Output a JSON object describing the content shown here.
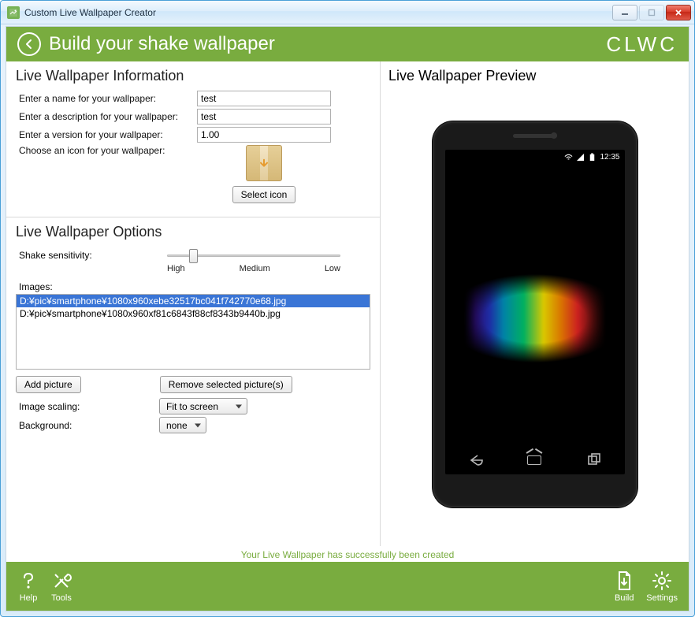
{
  "window": {
    "title": "Custom Live Wallpaper Creator"
  },
  "header": {
    "title": "Build your shake wallpaper",
    "brand": "CLWC"
  },
  "info": {
    "section_title": "Live Wallpaper Information",
    "name_label": "Enter a name for your wallpaper:",
    "name_value": "test",
    "desc_label": "Enter a description for your wallpaper:",
    "desc_value": "test",
    "version_label": "Enter a version for your wallpaper:",
    "version_value": "1.00",
    "icon_label": "Choose an icon for your wallpaper:",
    "select_icon_btn": "Select icon"
  },
  "options": {
    "section_title": "Live Wallpaper Options",
    "sensitivity_label": "Shake sensitivity:",
    "ticks": {
      "high": "High",
      "medium": "Medium",
      "low": "Low"
    },
    "images_label": "Images:",
    "images": [
      "D:¥pic¥smartphone¥1080x960xebe32517bc041f742770e68.jpg",
      "D:¥pic¥smartphone¥1080x960xf81c6843f88cf8343b9440b.jpg"
    ],
    "add_picture_btn": "Add picture",
    "remove_picture_btn": "Remove selected picture(s)",
    "scaling_label": "Image scaling:",
    "scaling_value": "Fit to screen",
    "background_label": "Background:",
    "background_value": "none"
  },
  "preview": {
    "section_title": "Live Wallpaper Preview",
    "statusbar_time": "12:35"
  },
  "status_message": "Your Live Wallpaper has successfully been created",
  "footer": {
    "help": "Help",
    "tools": "Tools",
    "build": "Build",
    "settings": "Settings"
  }
}
